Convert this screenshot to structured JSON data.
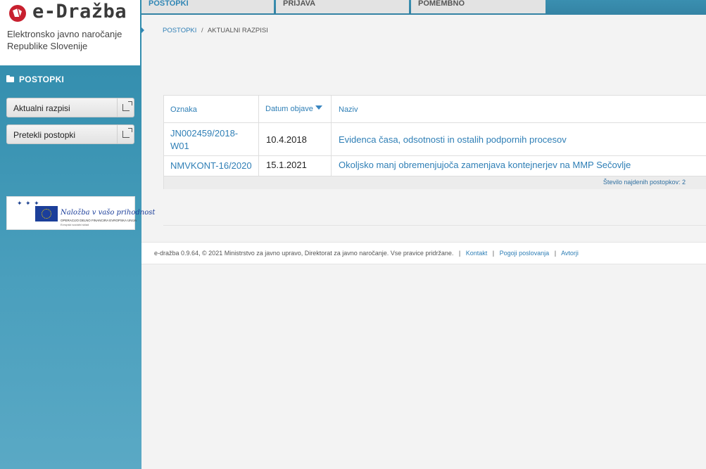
{
  "brand": {
    "logo_text": "e-Dražba",
    "subtitle_line1": "Elektronsko javno naročanje",
    "subtitle_line2": "Republike Slovenije"
  },
  "sidebar": {
    "heading": "POSTOPKI",
    "items": [
      {
        "label": "Aktualni razpisi",
        "icon": "external-link-icon"
      },
      {
        "label": "Pretekli postopki",
        "icon": "external-link-icon"
      }
    ],
    "eu_banner": {
      "title": "Naložba v vašo prihodnost",
      "line1": "OPERACIJO DELNO FINANCIRA EVROPSKA UNIJA",
      "line2": "Evropski socialni sklad"
    }
  },
  "top_tabs": [
    {
      "label": "POSTOPKI",
      "active": true
    },
    {
      "label": "PRIJAVA",
      "active": false
    },
    {
      "label": "POMEMBNO",
      "active": false
    }
  ],
  "breadcrumb": {
    "items": [
      "POSTOPKI",
      "AKTUALNI RAZPISI"
    ],
    "separator": "/"
  },
  "table": {
    "columns": [
      "Oznaka",
      "Datum objave",
      "Naziv"
    ],
    "sort_column": "Datum objave",
    "sort_direction": "descending",
    "rows": [
      {
        "code_line1": "JN002459/2018-",
        "code_line2": "W01",
        "date": "10.4.2018",
        "name": "Evidenca časa, odsotnosti in ostalih podpornih procesov"
      },
      {
        "code_line1": "NMVKONT-16/2020",
        "code_line2": "",
        "date": "15.1.2021",
        "name": "Okoljsko manj obremenjujoča zamenjava kontejnerjev na MMP Sečovlje"
      }
    ],
    "count_text": "Število najdenih postopkov: 2"
  },
  "footer": {
    "copyright": "e-dražba 0.9.64, © 2021 Ministrstvo za javno upravo, Direktorat za javno naročanje. Vse pravice pridržane.",
    "links": [
      "Kontakt",
      "Pogoji poslovanja",
      "Avtorji"
    ],
    "separator": "|"
  },
  "colors": {
    "sidebar_blue": "#3b94b3",
    "link_blue": "#2f7fb6",
    "logo_red": "#c8202f"
  }
}
